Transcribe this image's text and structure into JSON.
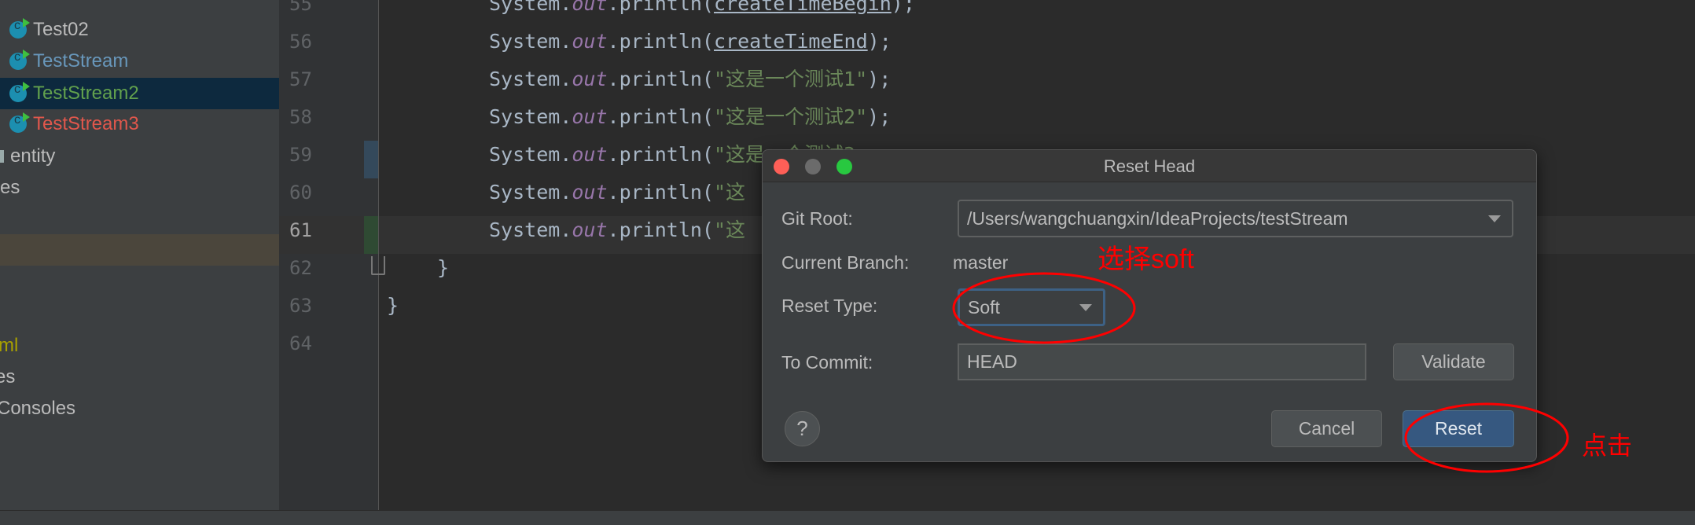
{
  "sidebar": {
    "items": [
      {
        "label": "Test02",
        "icon": "java-class-run-icon",
        "color": "#bbbbbb"
      },
      {
        "label": "TestStream",
        "icon": "java-class-run-icon",
        "color": "#6897bb"
      },
      {
        "label": "TestStream2",
        "icon": "java-class-run-icon",
        "color": "#62a14d",
        "selected": true
      },
      {
        "label": "TestStream3",
        "icon": "java-class-run-icon",
        "color": "#e0574c"
      },
      {
        "label": "entity",
        "icon": "folder-icon"
      },
      {
        "label": "es"
      },
      {
        "label": "ml",
        "color": "#a8a000"
      },
      {
        "label": "es"
      },
      {
        "label": "Consoles"
      }
    ]
  },
  "editor": {
    "line_numbers": [
      "55",
      "56",
      "57",
      "58",
      "59",
      "60",
      "61",
      "62",
      "63",
      "64"
    ],
    "current_line": "61",
    "code": {
      "sys": "System.",
      "out": "out",
      "println": ".println(",
      "l55_arg": "createTimeBegin",
      "l56_arg": "createTimeEnd",
      "l57_arg": "\"这是一个测试1\"",
      "l58_arg": "\"这是一个测试2\"",
      "l59_arg": "\"这是一个测试3",
      "l60_arg": "\"这",
      "l61_arg": "\"这",
      "close": ");",
      "brace": "}"
    }
  },
  "dialog": {
    "title": "Reset Head",
    "git_root_label": "Git Root:",
    "git_root_value": "/Users/wangchuangxin/IdeaProjects/testStream",
    "branch_label": "Current Branch:",
    "branch_value": "master",
    "reset_type_label": "Reset Type:",
    "reset_type_value": "Soft",
    "commit_label": "To Commit:",
    "commit_value": "HEAD",
    "validate": "Validate",
    "help": "?",
    "cancel": "Cancel",
    "reset": "Reset"
  },
  "annotations": {
    "select_soft": "选择soft",
    "click": "点击",
    "color": "#ff0000"
  }
}
